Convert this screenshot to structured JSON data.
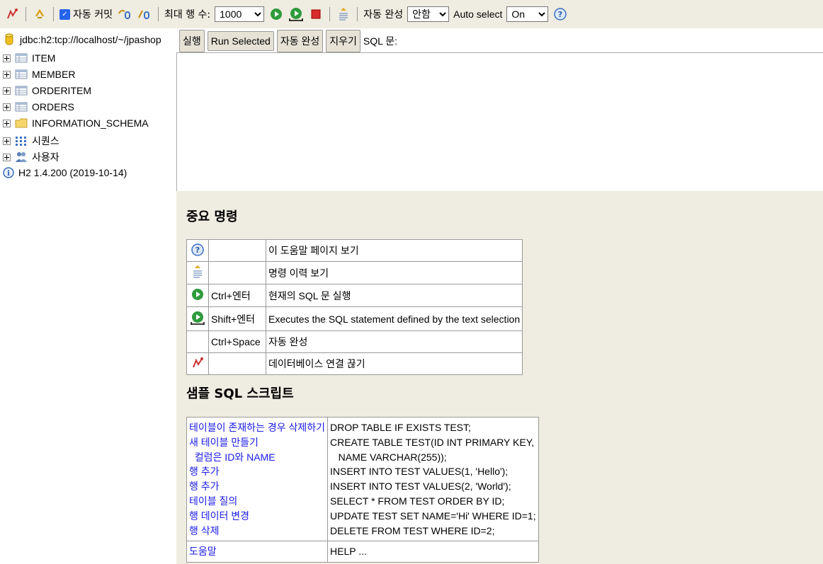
{
  "toolbar": {
    "autocommit_label": "자동 커밋",
    "maxrows_label": "최대 행 수:",
    "maxrows_value": "1000",
    "autocomplete_label": "자동 완성",
    "autocomplete_value": "안함",
    "autoselect_label": "Auto select",
    "autoselect_value": "On"
  },
  "connection": {
    "url": "jdbc:h2:tcp://localhost/~/jpashop"
  },
  "tree": {
    "items": [
      {
        "label": "ITEM"
      },
      {
        "label": "MEMBER"
      },
      {
        "label": "ORDERITEM"
      },
      {
        "label": "ORDERS"
      },
      {
        "label": "INFORMATION_SCHEMA"
      },
      {
        "label": "시퀀스"
      },
      {
        "label": "사용자"
      }
    ],
    "version": "H2 1.4.200 (2019-10-14)"
  },
  "sqlbar": {
    "run_label": "실행",
    "run_selected_label": "Run Selected",
    "autocomplete_label": "자동 완성",
    "clear_label": "지우기",
    "sql_label": "SQL 문:"
  },
  "help": {
    "title": "중요 명령",
    "rows": [
      {
        "key": "",
        "desc": "이 도움말 페이지 보기"
      },
      {
        "key": "",
        "desc": "명령 이력 보기"
      },
      {
        "key": "Ctrl+엔터",
        "desc": "현재의 SQL 문 실행"
      },
      {
        "key": "Shift+엔터",
        "desc": "Executes the SQL statement defined by the text selection"
      },
      {
        "key": "Ctrl+Space",
        "desc": "자동 완성"
      },
      {
        "key": "",
        "desc": "데이터베이스 연결 끊기"
      }
    ]
  },
  "sample": {
    "title": "샘플 SQL 스크립트",
    "rows": [
      {
        "label": "테이블이 존재하는 경우 삭제하기",
        "sql": "DROP TABLE IF EXISTS TEST;"
      },
      {
        "label": "새 테이블 만들기",
        "sql": "CREATE TABLE TEST(ID INT PRIMARY KEY,"
      },
      {
        "label": "  컬럼은 ID와 NAME",
        "sql": "   NAME VARCHAR(255));"
      },
      {
        "label": "행 추가",
        "sql": "INSERT INTO TEST VALUES(1, 'Hello');"
      },
      {
        "label": "행 추가",
        "sql": "INSERT INTO TEST VALUES(2, 'World');"
      },
      {
        "label": "테이블 질의",
        "sql": "SELECT * FROM TEST ORDER BY ID;"
      },
      {
        "label": "행 데이터 변경",
        "sql": "UPDATE TEST SET NAME='Hi' WHERE ID=1;"
      },
      {
        "label": "행 삭제",
        "sql": "DELETE FROM TEST WHERE ID=2;"
      }
    ],
    "help_label": "도움말",
    "help_sql": "HELP ..."
  }
}
